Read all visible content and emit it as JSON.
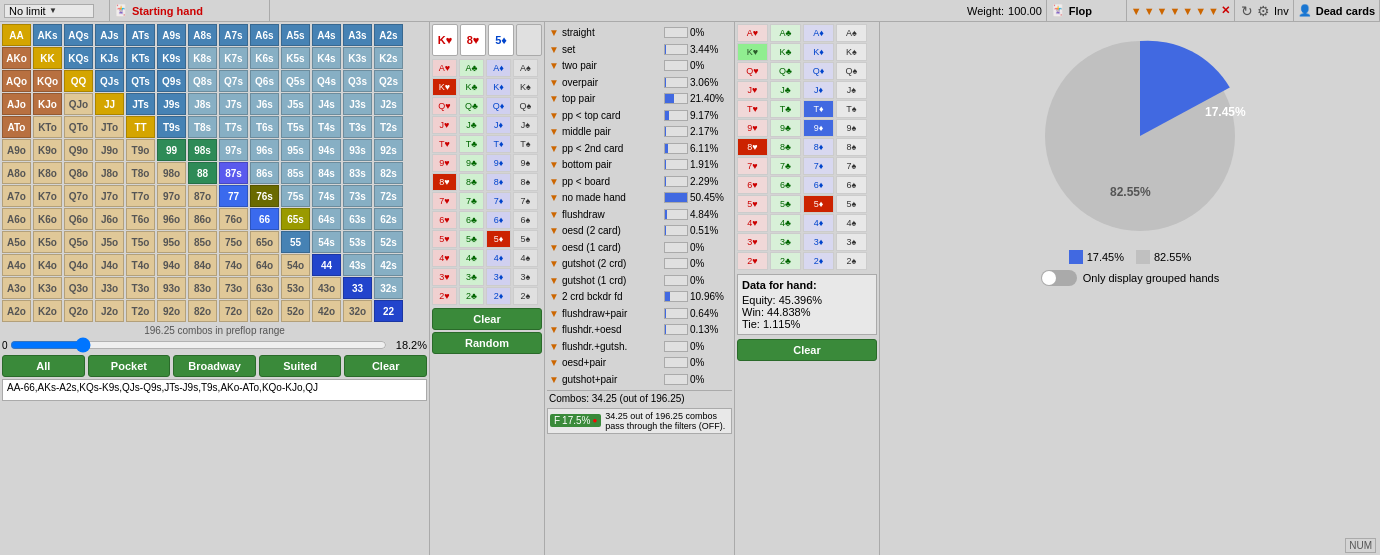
{
  "header": {
    "no_limit_label": "No limit",
    "starting_hand_label": "Starting hand",
    "weight_label": "Weight:",
    "weight_value": "100.00",
    "flop_label": "Flop",
    "inv_label": "Inv",
    "dead_cards_label": "Dead cards"
  },
  "matrix": {
    "combos_label": "196.25 combos in preflop range",
    "slider_pct": "18.2%",
    "slider_value": "0",
    "buttons": {
      "all": "All",
      "pocket": "Pocket",
      "broadway": "Broadway",
      "suited": "Suited",
      "clear": "Clear"
    },
    "range_text": "AA-66,AKs-A2s,KQs-K9s,QJs-Q9s,JTs-J9s,T9s,AKo-ATo,KQo-KJo,QJ"
  },
  "flop": {
    "card1": "K♥",
    "card1_color": "red",
    "card2": "8♥",
    "card2_color": "red",
    "card3": "5♦",
    "card3_color": "blue",
    "clear_label": "Clear",
    "random_label": "Random"
  },
  "stats": {
    "filters": [
      "▼",
      "▼",
      "▼",
      "▼",
      "▼",
      "▼",
      "▼",
      "X"
    ],
    "rows": [
      {
        "label": "straight",
        "pct": "0%",
        "bar": 0
      },
      {
        "label": "set",
        "pct": "3.44%",
        "bar": 6
      },
      {
        "label": "two pair",
        "pct": "0%",
        "bar": 0
      },
      {
        "label": "overpair",
        "pct": "3.06%",
        "bar": 6
      },
      {
        "label": "top pair",
        "pct": "21.40%",
        "bar": 43
      },
      {
        "label": "pp < top card",
        "pct": "9.17%",
        "bar": 18
      },
      {
        "label": "middle pair",
        "pct": "2.17%",
        "bar": 4
      },
      {
        "label": "pp < 2nd card",
        "pct": "6.11%",
        "bar": 12
      },
      {
        "label": "bottom pair",
        "pct": "1.91%",
        "bar": 4
      },
      {
        "label": "pp < board",
        "pct": "2.29%",
        "bar": 5
      },
      {
        "label": "no made hand",
        "pct": "50.45%",
        "bar": 100
      },
      {
        "label": "flushdraw",
        "pct": "4.84%",
        "bar": 10
      },
      {
        "label": "oesd (2 card)",
        "pct": "0.51%",
        "bar": 1
      },
      {
        "label": "oesd (1 card)",
        "pct": "0%",
        "bar": 0
      },
      {
        "label": "gutshot (2 crd)",
        "pct": "0%",
        "bar": 0
      },
      {
        "label": "gutshot (1 crd)",
        "pct": "0%",
        "bar": 0
      },
      {
        "label": "2 crd bckdr fd",
        "pct": "10.96%",
        "bar": 22
      },
      {
        "label": "flushdraw+pair",
        "pct": "0.64%",
        "bar": 1
      },
      {
        "label": "flushdr.+oesd",
        "pct": "0.13%",
        "bar": 0.5
      },
      {
        "label": "flushdr.+gutsh.",
        "pct": "0%",
        "bar": 0
      },
      {
        "label": "oesd+pair",
        "pct": "0%",
        "bar": 0
      },
      {
        "label": "gutshot+pair",
        "pct": "0%",
        "bar": 0
      }
    ],
    "combos_text": "Combos: 34.25 (out of 196.25)",
    "filter_pass_text": "34.25 out of 196.25 combos pass through the filters (OFF).",
    "filter_badge_pct": "17.5%"
  },
  "dead_cards": {
    "rows_labels": [
      [
        "Ah",
        "Ac",
        "Ad",
        "As"
      ],
      [
        "Kh",
        "Kc",
        "Kd",
        "Ks"
      ],
      [
        "Qh",
        "Qc",
        "Qd",
        "Qs"
      ],
      [
        "Jh",
        "Jc",
        "Jd",
        "Js"
      ],
      [
        "Th",
        "Tc",
        "Td",
        "Ts"
      ],
      [
        "9h",
        "9c",
        "9d",
        "9s"
      ],
      [
        "8h",
        "8c",
        "8d",
        "8s"
      ],
      [
        "7h",
        "7c",
        "7d",
        "7s"
      ],
      [
        "6h",
        "6c",
        "6d",
        "6s"
      ],
      [
        "5h",
        "5c",
        "5d",
        "5s"
      ],
      [
        "4h",
        "4c",
        "4d",
        "4s"
      ],
      [
        "3h",
        "3c",
        "3d",
        "3s"
      ],
      [
        "2h",
        "2c",
        "2d",
        "2s"
      ]
    ],
    "data_for_hand": {
      "title": "Data for hand:",
      "equity_label": "Equity:",
      "equity_value": "45.396%",
      "win_label": "Win:",
      "win_value": "44.838%",
      "tie_label": "Tie:",
      "tie_value": "1.115%"
    },
    "clear_label": "Clear"
  },
  "pie_chart": {
    "blue_pct": 17.45,
    "gray_pct": 82.55,
    "blue_label": "17.45%",
    "gray_label": "82.55%",
    "legend": [
      {
        "label": "17.45%",
        "color": "#4169e1"
      },
      {
        "label": "82.55%",
        "color": "#c0c0c0"
      }
    ]
  },
  "only_grouped": {
    "label": "Only display grouped hands"
  },
  "num_badge": "NUM"
}
